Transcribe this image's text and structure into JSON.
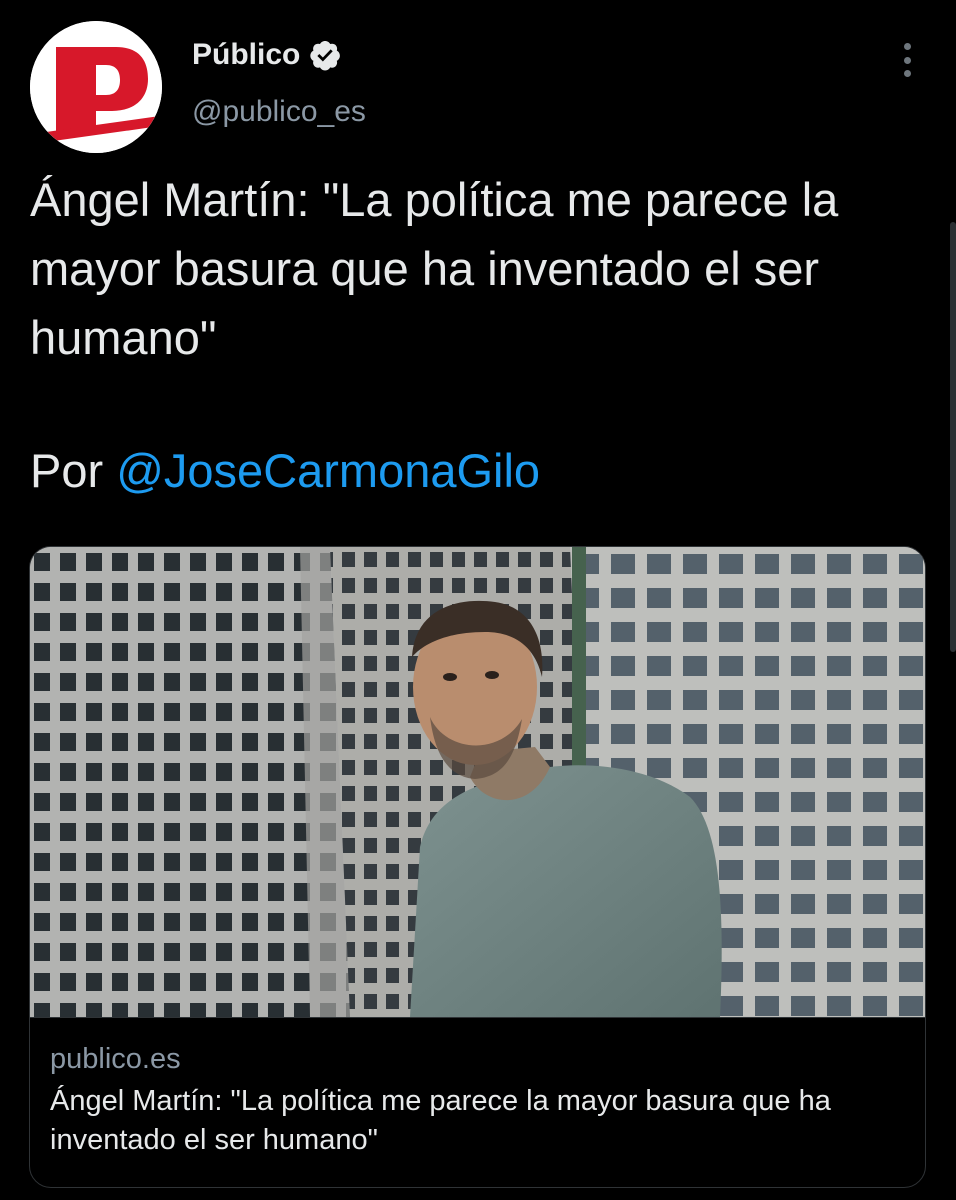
{
  "tweet": {
    "author": {
      "display_name": "Público",
      "handle": "@publico_es",
      "verified": true,
      "avatar_letter": "P"
    },
    "text": "Ángel Martín: \"La política me parece la mayor basura que ha inventado el ser humano\"",
    "byline_prefix": "Por",
    "byline_mention": "@JoseCarmonaGilo",
    "card": {
      "domain": "publico.es",
      "title": "Ángel Martín: \"La política me parece la mayor basura que ha inventado el ser humano\""
    }
  },
  "icons": {
    "verified": "verified-badge-icon",
    "more": "more-options-icon"
  },
  "colors": {
    "background": "#000000",
    "primary_text": "#e7e9ea",
    "secondary_text": "#8b98a5",
    "link": "#1d9bf0",
    "brand_red": "#d7182a"
  }
}
